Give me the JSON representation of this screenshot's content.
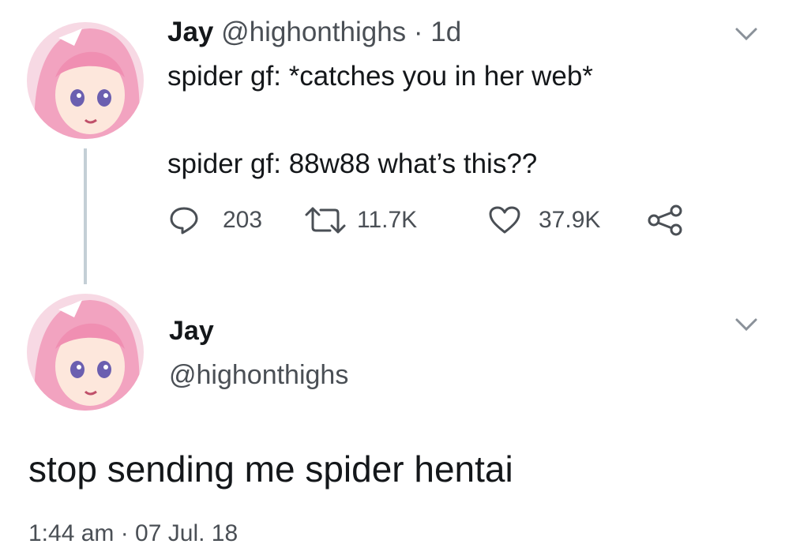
{
  "tweet1": {
    "author_name": "Jay",
    "author_handle": "@highonthighs",
    "separator": "·",
    "age": "1d",
    "line1": "spider gf: *catches you in her web*",
    "line2": "spider gf: 88w88 what’s this??",
    "replies": "203",
    "retweets": "11.7K",
    "likes": "37.9K"
  },
  "tweet2": {
    "author_name": "Jay",
    "author_handle": "@highonthighs",
    "text": "stop sending me spider hentai",
    "timestamp": "1:44 am · 07 Jul. 18"
  },
  "icons": {
    "reply": "reply-icon",
    "retweet": "retweet-icon",
    "like": "heart-icon",
    "share": "share-icon",
    "menu": "chevron-down-icon"
  },
  "colors": {
    "text_primary": "#14171a",
    "text_secondary": "#4a4f55",
    "thread_line": "#c4cfd6",
    "avatar_hair": "#f2a3c0"
  }
}
